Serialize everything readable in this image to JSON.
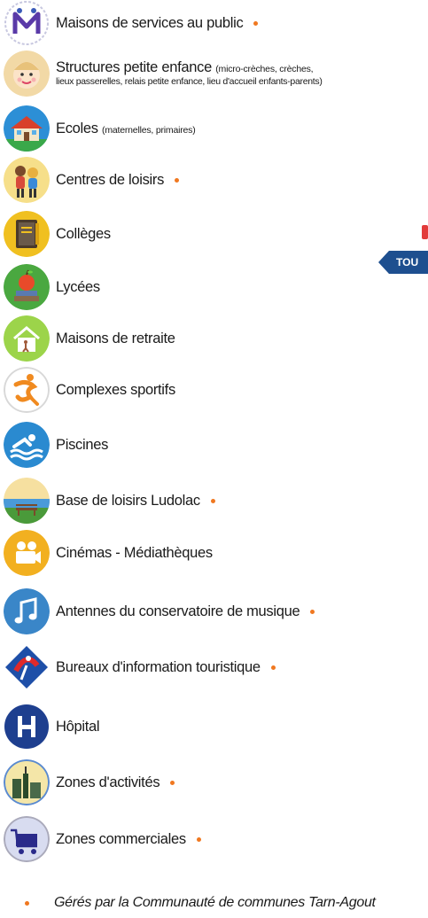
{
  "items": [
    {
      "label": "Maisons de services au public",
      "sub": "",
      "managed": true,
      "icon": "msap-logo-icon"
    },
    {
      "label": "Structures petite enfance",
      "sub": "(micro-crèches, crèches,",
      "line2": "lieux passerelles, relais petite enfance, lieu d'accueil enfants-parents)",
      "managed": false,
      "icon": "baby-icon"
    },
    {
      "label": "Ecoles",
      "sub": "(maternelles, primaires)",
      "managed": false,
      "icon": "school-icon"
    },
    {
      "label": "Centres de loisirs",
      "sub": "",
      "managed": true,
      "icon": "children-playing-icon"
    },
    {
      "label": "Collèges",
      "sub": "",
      "managed": false,
      "icon": "book-icon"
    },
    {
      "label": "Lycées",
      "sub": "",
      "managed": false,
      "icon": "apple-books-icon"
    },
    {
      "label": "Maisons de retraite",
      "sub": "",
      "managed": false,
      "icon": "retirement-home-icon"
    },
    {
      "label": "Complexes sportifs",
      "sub": "",
      "managed": false,
      "icon": "athlete-icon"
    },
    {
      "label": "Piscines",
      "sub": "",
      "managed": false,
      "icon": "swimmer-icon"
    },
    {
      "label": "Base de loisirs Ludolac",
      "sub": "",
      "managed": true,
      "icon": "lake-bench-icon"
    },
    {
      "label": "Cinémas - Médiathèques",
      "sub": "",
      "managed": false,
      "icon": "movie-camera-icon"
    },
    {
      "label": "Antennes du conservatoire de musique",
      "sub": "",
      "managed": true,
      "icon": "music-note-icon"
    },
    {
      "label": "Bureaux d'information touristique",
      "sub": "",
      "managed": true,
      "icon": "tourist-info-icon"
    },
    {
      "label": "Hôpital",
      "sub": "",
      "managed": false,
      "icon": "hospital-h-icon"
    },
    {
      "label": "Zones d'activités",
      "sub": "",
      "managed": true,
      "icon": "factory-icon"
    },
    {
      "label": "Zones commerciales",
      "sub": "",
      "managed": true,
      "icon": "shopping-cart-icon"
    }
  ],
  "footnote": "Gérés par la Communauté de communes Tarn-Agout",
  "map_fragment": {
    "label": "TOU"
  },
  "colors": {
    "dot": "#f07820",
    "hospital": "#1e3f8f",
    "music": "#3a86c8"
  }
}
